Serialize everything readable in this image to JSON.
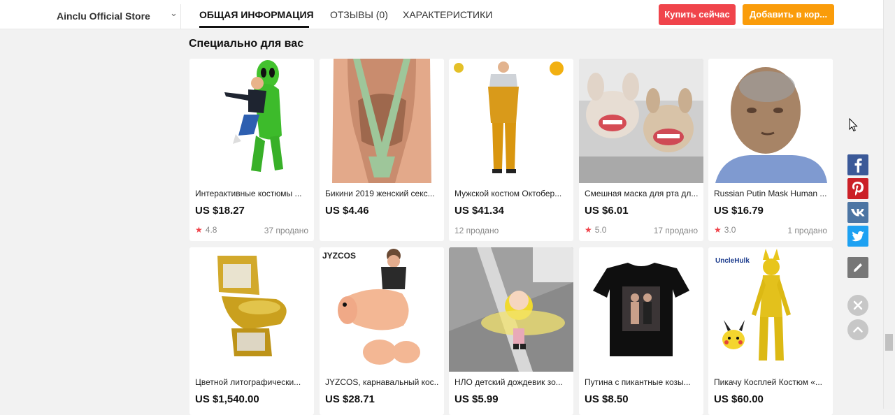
{
  "header": {
    "store_name": "Ainclu Official Store",
    "tabs": [
      {
        "label": "ОБЩАЯ ИНФОРМАЦИЯ"
      },
      {
        "label": "ОТЗЫВЫ (0)"
      },
      {
        "label": "ХАРАКТЕРИСТИКИ"
      }
    ],
    "buy_now": "Купить сейчас",
    "add_to_cart": "Добавить в кор..."
  },
  "section_title": "Специально для вас",
  "products": [
    {
      "title": "Интерактивные костюмы ...",
      "price": "US $18.27",
      "rating": "4.8",
      "sold": "37 продано"
    },
    {
      "title": "Бикини 2019 женский секс...",
      "price": "US $4.46",
      "rating": "",
      "sold": ""
    },
    {
      "title": "Мужской костюм Октобер...",
      "price": "US $41.34",
      "rating": "",
      "sold": "12 продано"
    },
    {
      "title": "Смешная маска для рта дл...",
      "price": "US $6.01",
      "rating": "5.0",
      "sold": "17 продано"
    },
    {
      "title": "Russian Putin Mask Human ...",
      "price": "US $16.79",
      "rating": "3.0",
      "sold": "1 продано"
    },
    {
      "title": "Цветной литографически...",
      "price": "US $1,540.00"
    },
    {
      "title": "JYZCOS, карнавальный кос...",
      "price": "US $28.71"
    },
    {
      "title": "НЛО детский дождевик зо...",
      "price": "US $5.99"
    },
    {
      "title": "Путина с пикантные козы...",
      "price": "US $8.50"
    },
    {
      "title": "Пикачу Косплей Костюм «...",
      "price": "US $60.00"
    }
  ],
  "image_labels": {
    "jyzcos": "JYZCOS",
    "unclehulk": "UncleHulk"
  },
  "icons": {
    "facebook": "facebook-icon",
    "pinterest": "pinterest-icon",
    "vk": "vk-icon",
    "twitter": "twitter-icon",
    "edit": "pencil-icon",
    "close": "close-icon",
    "up": "arrow-up-icon"
  },
  "colors": {
    "buy": "#f0444b",
    "cart": "#fa9c0a",
    "facebook": "#3b5998",
    "pinterest": "#cb2027",
    "vk": "#4c75a3",
    "twitter": "#1da1f2"
  }
}
